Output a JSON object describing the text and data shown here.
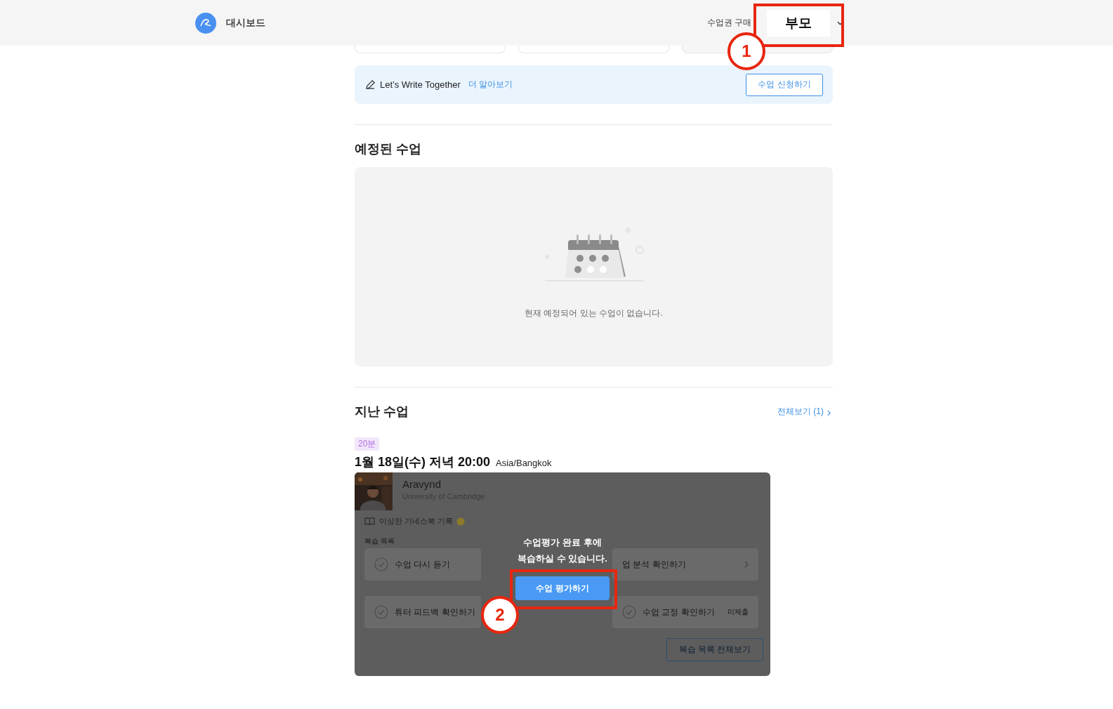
{
  "header": {
    "title": "대시보드",
    "purchase_link": "수업권 구매",
    "profile": "부모"
  },
  "banner": {
    "text": "Let’s Write Together",
    "link": "더 알아보기",
    "button": "수업 신청하기"
  },
  "upcoming": {
    "title": "예정된 수업",
    "empty_message": "현재 예정되어 있는 수업이 없습니다."
  },
  "past": {
    "title": "지난 수업",
    "view_all": "전체보기 (1)",
    "lessons": [
      {
        "duration": "20분",
        "date": "1월 18일(수) 저녁 20:00",
        "timezone": "Asia/Bangkok",
        "tutor": {
          "name": "Aravynd",
          "school": "University of Cambridge"
        },
        "material": "이상한 기네스북 기록",
        "review_title": "복습 목록",
        "review_items": [
          {
            "kind": "check",
            "label": "수업 다시 듣기"
          },
          {
            "kind": "link",
            "label": "업 분석 확인하기"
          },
          {
            "kind": "check",
            "label": "튜터 피드백 확인하기"
          },
          {
            "kind": "check",
            "label": "수업 교정 확인하기",
            "status": "미제출"
          }
        ],
        "review_all": "복습 목록 전체보기",
        "lock_message": [
          "수업평가 완료 후에",
          "복습하실 수 있습니다."
        ],
        "lock_button": "수업 평가하기"
      }
    ]
  },
  "annotations": [
    {
      "label": "1"
    },
    {
      "label": "2"
    }
  ]
}
